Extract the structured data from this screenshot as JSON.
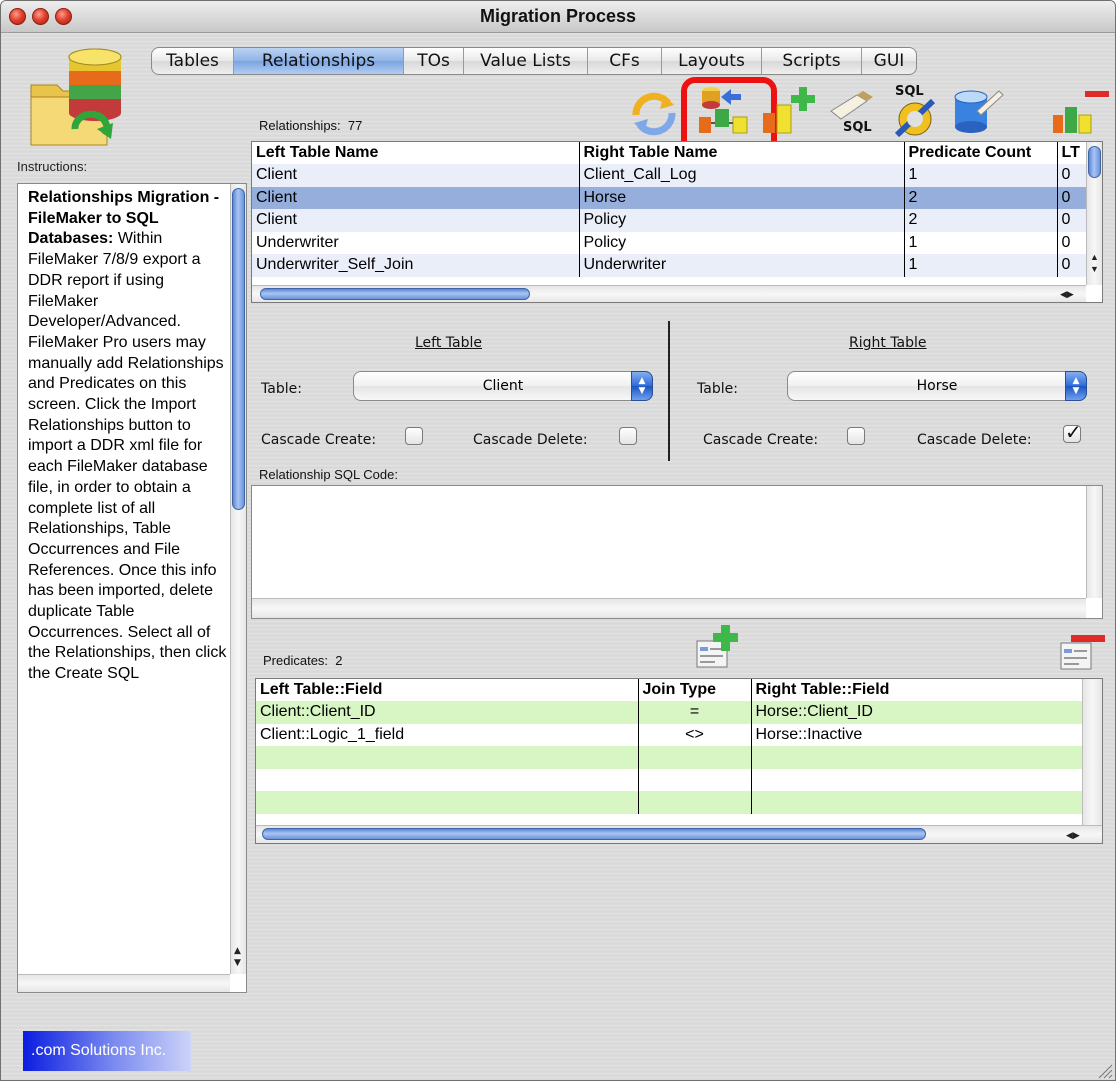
{
  "window": {
    "title": "Migration Process"
  },
  "tabs": [
    {
      "label": "Tables",
      "width": 82,
      "active": false
    },
    {
      "label": "Relationships",
      "width": 170,
      "active": true
    },
    {
      "label": "TOs",
      "width": 60,
      "active": false
    },
    {
      "label": "Value Lists",
      "width": 124,
      "active": false
    },
    {
      "label": "CFs",
      "width": 74,
      "active": false
    },
    {
      "label": "Layouts",
      "width": 100,
      "active": false
    },
    {
      "label": "Scripts",
      "width": 100,
      "active": false
    },
    {
      "label": "GUI",
      "width": 54,
      "active": false
    }
  ],
  "toolbar": {
    "sql_label": "SQL",
    "sql_label_2": "SQL"
  },
  "instructions": {
    "label": "Instructions:",
    "heading": "Relationships Migration - FileMaker to SQL Databases:",
    "body": "Within FileMaker 7/8/9 export a DDR report if using FileMaker Developer/Advanced. FileMaker Pro users may manually add Relationships and Predicates on this screen. Click the Import Relationships button to import a DDR xml file for each FileMaker database file, in order to obtain a complete list of all Relationships, Table Occurrences and File References. Once this info has been imported, delete duplicate Table Occurrences. Select all of the Relationships, then click the Create SQL"
  },
  "relationships": {
    "label": "Relationships:",
    "count": "77",
    "columns": [
      "Left Table Name",
      "Right Table Name",
      "Predicate Count",
      "LT"
    ],
    "rows": [
      [
        "Client",
        "Client_Call_Log",
        "1",
        "0"
      ],
      [
        "Client",
        "Horse",
        "2",
        "0"
      ],
      [
        "Client",
        "Policy",
        "2",
        "0"
      ],
      [
        "Underwriter",
        "Policy",
        "1",
        "0"
      ],
      [
        "Underwriter_Self_Join",
        "Underwriter",
        "1",
        "0"
      ]
    ],
    "selected_row": 1
  },
  "left_table": {
    "heading": "Left Table",
    "table_label": "Table:",
    "table_value": "Client",
    "cascade_create_label": "Cascade Create:",
    "cascade_create": false,
    "cascade_delete_label": "Cascade Delete:",
    "cascade_delete": false
  },
  "right_table": {
    "heading": "Right Table",
    "table_label": "Table:",
    "table_value": "Horse",
    "cascade_create_label": "Cascade Create:",
    "cascade_create": false,
    "cascade_delete_label": "Cascade Delete:",
    "cascade_delete": true
  },
  "sql_code": {
    "label": "Relationship SQL Code:",
    "value": ""
  },
  "predicates": {
    "label": "Predicates:",
    "count": "2",
    "columns": [
      "Left Table::Field",
      "Join Type",
      "Right Table::Field"
    ],
    "rows": [
      [
        "Client::Client_ID",
        "=",
        "Horse::Client_ID"
      ],
      [
        "Client::Logic_1_field",
        "<>",
        "Horse::Inactive"
      ],
      [
        "",
        "",
        ""
      ],
      [
        "",
        "",
        ""
      ],
      [
        "",
        "",
        ""
      ]
    ]
  },
  "company": {
    "label": ".com Solutions Inc."
  },
  "colors": {
    "selection": "#96aedb",
    "highlight": "#ee1111",
    "green_row": "#d8f5c4"
  }
}
